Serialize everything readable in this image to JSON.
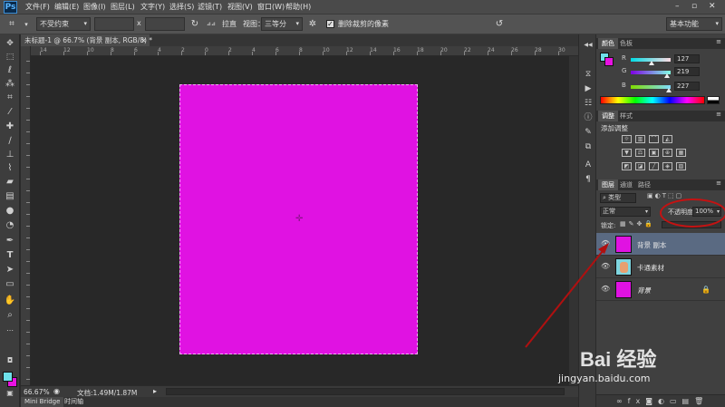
{
  "app": {
    "logo": "Ps"
  },
  "menu": [
    "文件(F)",
    "编辑(E)",
    "图像(I)",
    "图层(L)",
    "文字(Y)",
    "选择(S)",
    "滤镜(T)",
    "视图(V)",
    "窗口(W)",
    "帮助(H)"
  ],
  "options": {
    "ratio_select": "不受约束",
    "x_sep": "x",
    "straighten": "拉直",
    "view_label": "视图：",
    "view_select": "三等分",
    "delete_cropped": "删除裁剪的像素",
    "workspace": "基本功能"
  },
  "document": {
    "tab_title": "未标题-1 @ 66.7% (背景 副本, RGB/8) *",
    "close": "×",
    "canvas_color": "#e012e2"
  },
  "rulers": {
    "top": [
      "14",
      "12",
      "10",
      "8",
      "6",
      "4",
      "2",
      "0",
      "2",
      "4",
      "6",
      "8",
      "10",
      "12",
      "14",
      "16",
      "18",
      "20",
      "22",
      "24",
      "26",
      "28",
      "30",
      "32"
    ]
  },
  "status": {
    "zoom": "66.67%",
    "doc_info": "文档:1.49M/1.87M"
  },
  "bottom_tabs": [
    "Mini Bridge",
    "时间轴"
  ],
  "color_panel": {
    "tabs": [
      "颜色",
      "色板"
    ],
    "channels": [
      {
        "label": "R",
        "value": "127",
        "level": 0.5
      },
      {
        "label": "G",
        "value": "219",
        "level": 0.86
      },
      {
        "label": "B",
        "value": "227",
        "level": 0.89
      }
    ],
    "fg_color": "#6ee0ea",
    "bg_color": "#e812e2"
  },
  "adjust_panel": {
    "tabs": [
      "调整",
      "样式"
    ],
    "title": "添加调整"
  },
  "layers_panel": {
    "tabs": [
      "图层",
      "通道",
      "路径"
    ],
    "filter": "类型",
    "blend_mode": "正常",
    "opacity_label": "不透明度:",
    "opacity_value": "100%",
    "lock_label": "锁定:",
    "layers": [
      {
        "name": "背景 副本",
        "selected": true,
        "thumb": "#e012e2"
      },
      {
        "name": "卡通素材",
        "selected": false,
        "thumb": "#7fd6e0"
      },
      {
        "name": "背景",
        "selected": false,
        "thumb": "#e012e2",
        "locked": true
      }
    ]
  },
  "watermark": {
    "brand": "Bai 经验",
    "url": "jingyan.baidu.com"
  }
}
